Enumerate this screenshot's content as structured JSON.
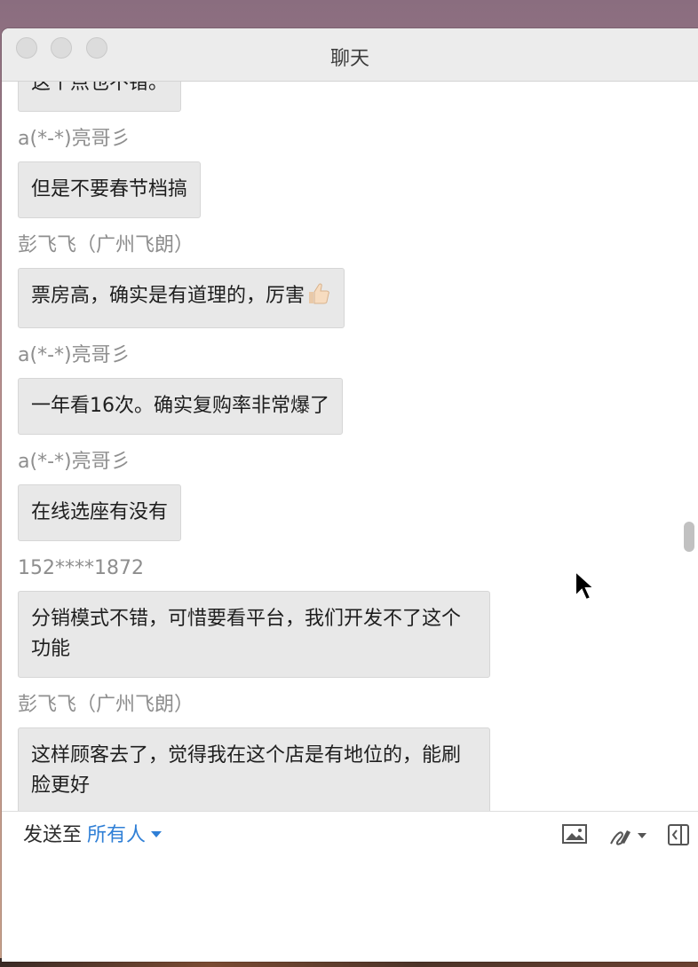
{
  "window": {
    "title": "聊天"
  },
  "messages": [
    {
      "sender": "",
      "text": "这个点也不错。"
    },
    {
      "sender": "a(*-*)亮哥彡",
      "text": "但是不要春节档搞"
    },
    {
      "sender": "彭飞飞（广州飞朗）",
      "text": "票房高，确实是有道理的，厉害",
      "emoji": "thumbs-up-icon"
    },
    {
      "sender": "a(*-*)亮哥彡",
      "text": "一年看16次。确实复购率非常爆了"
    },
    {
      "sender": "a(*-*)亮哥彡",
      "text": "在线选座有没有"
    },
    {
      "sender": "152****1872",
      "text": "分销模式不错，可惜要看平台，我们开发不了这个功能"
    },
    {
      "sender": "彭飞飞（广州飞朗）",
      "text": "这样顾客去了，觉得我在这个店是有地位的，能刷脸更好"
    }
  ],
  "composer": {
    "send_to_label": "发送至",
    "recipient": "所有人",
    "tools": [
      "image-icon",
      "whiteboard-icon",
      "exit-panel-icon"
    ]
  },
  "colors": {
    "accent": "#2f7fd6",
    "bubble": "#e8e8e8"
  }
}
